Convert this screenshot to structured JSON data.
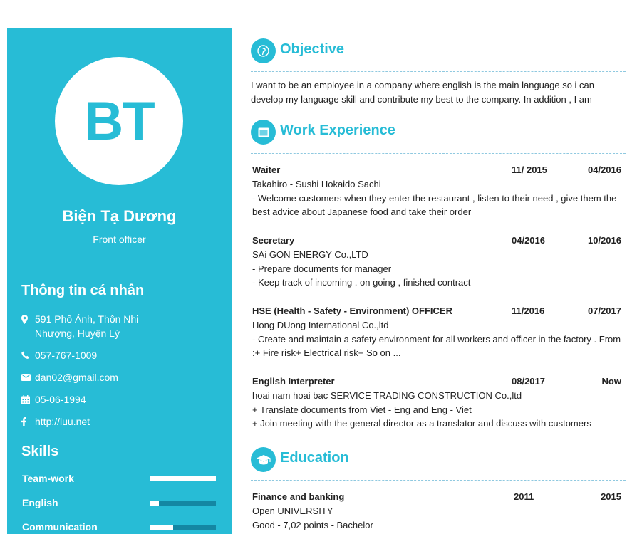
{
  "profile": {
    "initials": "BT",
    "name": "Biện Tạ Dương",
    "role": "Front officer"
  },
  "personal": {
    "title": "Thông tin cá nhân",
    "address": "591 Phố Ánh, Thôn Nhi Nhượng, Huyện Lý",
    "phone": "057-767-1009",
    "email": "dan02@gmail.com",
    "birthday": "05-06-1994",
    "website": "http://luu.net"
  },
  "skills": {
    "title": "Skills",
    "items": [
      {
        "label": "Team-work",
        "level": 1.0
      },
      {
        "label": "English",
        "level": 0.14
      },
      {
        "label": "Communication",
        "level": 0.36
      }
    ]
  },
  "objective": {
    "title": "Objective",
    "text": "I want to be an employee in a company where english is the main language so i can develop my language skill and contribute my best to the company. In addition , I am"
  },
  "work": {
    "title": "Work Experience",
    "jobs": [
      {
        "position": "Waiter",
        "start": "11/ 2015",
        "end": "04/2016",
        "company": "Takahiro - Sushi Hokaido Sachi",
        "lines": [
          "- Welcome customers when they enter the restaurant , listen to their need , give them the best advice about Japanese food and take their order"
        ]
      },
      {
        "position": "Secretary",
        "start": "04/2016",
        "end": "10/2016",
        "company": "SAi GON ENERGY Co.,LTD",
        "lines": [
          "- Prepare documents for manager",
          "- Keep track of incoming , on going , finished contract"
        ]
      },
      {
        "position": "HSE (Health - Safety - Environment) OFFICER",
        "start": "11/2016",
        "end": "07/2017",
        "company": "Hong DUong International Co.,ltd",
        "lines": [
          "- Create and maintain a safety environment for all workers and officer in the factory . From :+ Fire risk+ Electrical risk+ So on ..."
        ]
      },
      {
        "position": "English Interpreter",
        "start": "08/2017",
        "end": "Now",
        "company": "hoai nam hoai bac SERVICE TRADING CONSTRUCTION Co.,ltd",
        "lines": [
          "+ Translate documents from Viet - Eng and Eng - Viet",
          "+ Join meeting with the general director as a translator and discuss with customers"
        ]
      }
    ]
  },
  "education": {
    "title": "Education",
    "items": [
      {
        "major": "Finance and banking",
        "start": "2011",
        "end": "2015",
        "school": "Open UNIVERSITY",
        "detail": "Good - 7,02 points - Bachelor"
      }
    ]
  },
  "icons": {
    "objective": "pinterest-icon",
    "work": "briefcase-icon",
    "education": "graduation-cap-icon",
    "address": "map-marker-icon",
    "phone": "phone-icon",
    "email": "envelope-icon",
    "birthday": "calendar-icon",
    "website": "facebook-icon"
  },
  "colors": {
    "accent": "#27bcd6",
    "skill_track": "#1487a3"
  }
}
